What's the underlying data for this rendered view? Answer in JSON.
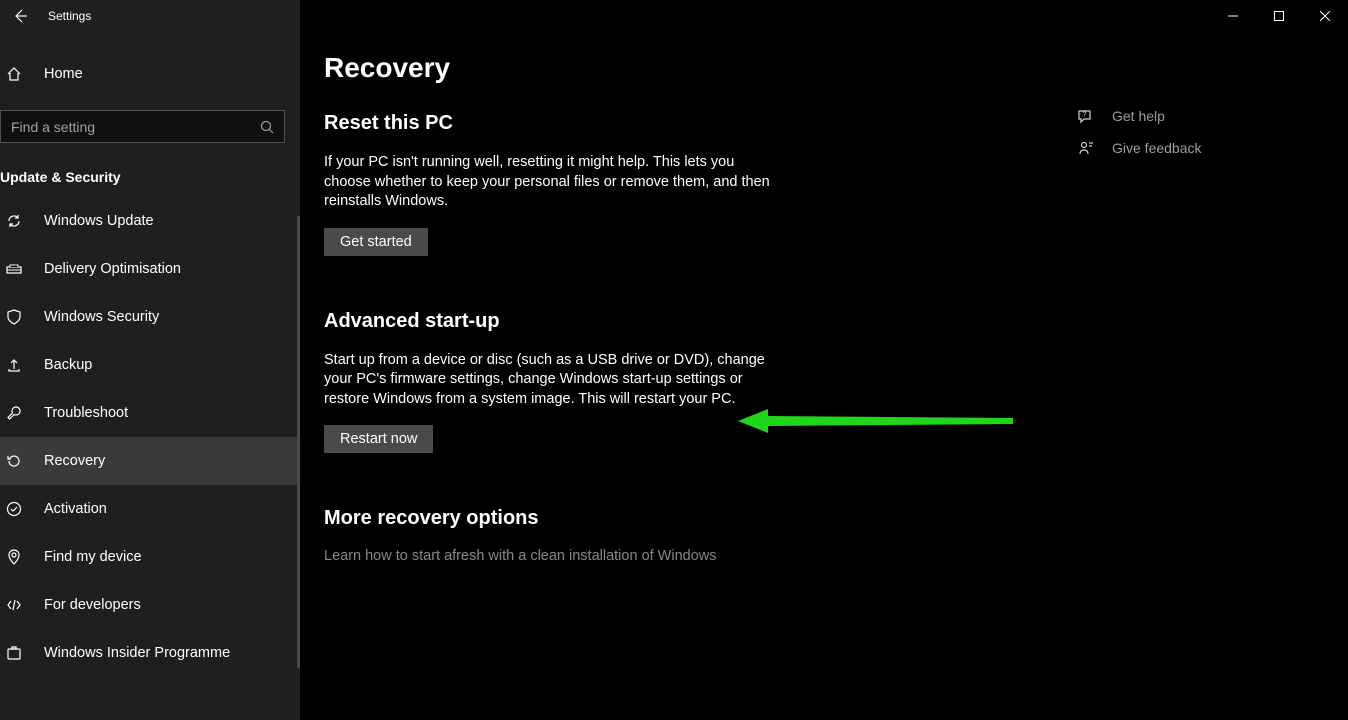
{
  "titlebar": {
    "title": "Settings"
  },
  "sidebar": {
    "home_label": "Home",
    "search_placeholder": "Find a setting",
    "section_header": "Update & Security",
    "items": [
      {
        "label": "Windows Update"
      },
      {
        "label": "Delivery Optimisation"
      },
      {
        "label": "Windows Security"
      },
      {
        "label": "Backup"
      },
      {
        "label": "Troubleshoot"
      },
      {
        "label": "Recovery"
      },
      {
        "label": "Activation"
      },
      {
        "label": "Find my device"
      },
      {
        "label": "For developers"
      },
      {
        "label": "Windows Insider Programme"
      }
    ]
  },
  "main": {
    "page_title": "Recovery",
    "reset": {
      "heading": "Reset this PC",
      "body": "If your PC isn't running well, resetting it might help. This lets you choose whether to keep your personal files or remove them, and then reinstalls Windows.",
      "button": "Get started"
    },
    "advanced": {
      "heading": "Advanced start-up",
      "body": "Start up from a device or disc (such as a USB drive or DVD), change your PC's firmware settings, change Windows start-up settings or restore Windows from a system image. This will restart your PC.",
      "button": "Restart now"
    },
    "more": {
      "heading": "More recovery options",
      "link": "Learn how to start afresh with a clean installation of Windows"
    }
  },
  "help": {
    "get_help": "Get help",
    "give_feedback": "Give feedback"
  },
  "colors": {
    "arrow": "#1fd61b"
  }
}
